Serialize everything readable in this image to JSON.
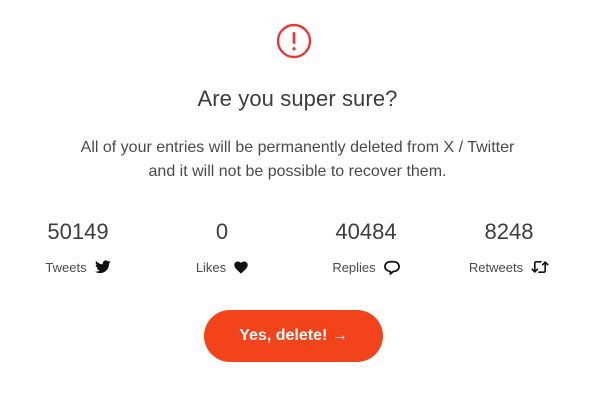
{
  "dialog": {
    "icon": "exclamation-circle-icon",
    "title": "Are you super sure?",
    "message_line1": "All of your entries will be permanently deleted from X / Twitter",
    "message_line2": "and it will not be possible to recover them.",
    "stats": [
      {
        "value": "50149",
        "label": "Tweets",
        "icon": "twitter-bird-icon"
      },
      {
        "value": "0",
        "label": "Likes",
        "icon": "heart-icon"
      },
      {
        "value": "40484",
        "label": "Replies",
        "icon": "speech-bubble-icon"
      },
      {
        "value": "8248",
        "label": "Retweets",
        "icon": "retweet-icon"
      }
    ],
    "confirm_label": "Yes, delete! →"
  },
  "colors": {
    "accent": "#f2431a",
    "warning": "#e53935",
    "text": "#3d3d3d"
  }
}
